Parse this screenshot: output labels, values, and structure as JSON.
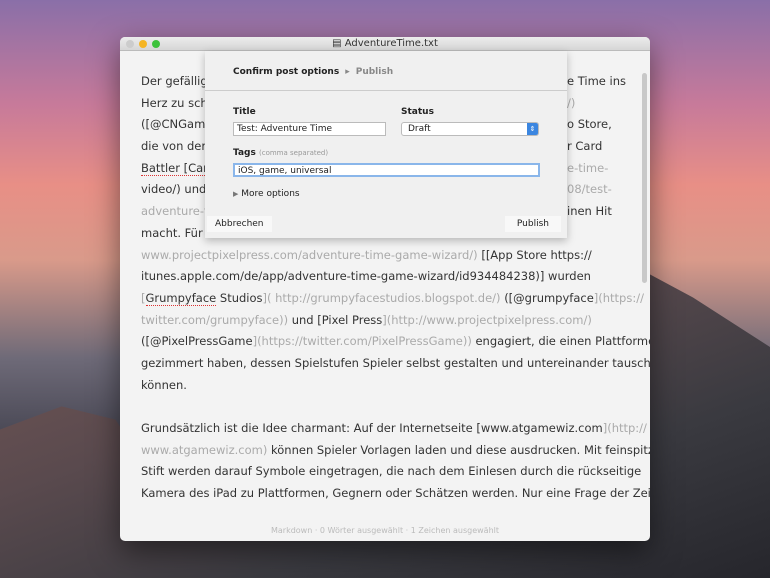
{
  "window": {
    "title": "AdventureTime.txt"
  },
  "sheet": {
    "breadcrumb": [
      "Confirm post options",
      "Publish"
    ],
    "title_label": "Title",
    "title_value": "Test: Adventure Time",
    "status_label": "Status",
    "status_value": "Draft",
    "tags_label": "Tags",
    "tags_hint": "(comma separated)",
    "tags_value": "iOS, game, universal",
    "more_options": "More options",
    "cancel": "Abbrechen",
    "publish": "Publish"
  },
  "lines": [
    [
      "Der gefällige",
      "e Time ins"
    ],
    [
      "Herz zu schli",
      "/)"
    ],
    [
      "([@CNGame",
      "o Store,"
    ],
    [
      "die von der I",
      "r Card"
    ],
    [
      "Battler [Card",
      "e-time-"
    ],
    [
      "video/) und d",
      "08/test-"
    ],
    [
      "adventure-ti",
      "inen Hit"
    ],
    [
      "macht. Für d",
      ""
    ]
  ],
  "para1": [
    "www.projectpixelpress.com/adventure-time-game-wizard/)",
    "[[App Store https://",
    "itunes.apple.com/de/app/adventure-time-game-wizard/id934484238)] wurden",
    "[",
    "Grumpyface",
    "Studios",
    "]( http://grumpyfacestudios.blogspot.de/)",
    "([@grumpyface",
    "](https://",
    "twitter.com/grumpyface))",
    "und [Pixel Press",
    "](http://www.projectpixelpress.com/)",
    "([@PixelPressGame",
    "](https://twitter.com/PixelPressGame))",
    "engagiert, die einen Plattformer",
    "gezimmert haben, dessen Spielstufen Spieler selbst gestalten und untereinander tauschen",
    "können."
  ],
  "para2": [
    "Grundsätzlich ist die Idee charmant: Auf der Internetseite [www.atgamewiz.com",
    "](http://",
    "www.atgamewiz.com)",
    "können Spieler Vorlagen laden und diese ausdrucken. Mit feinspitzem",
    "Stift werden darauf Symbole eingetragen, die nach dem Einlesen durch die rückseitige",
    "Kamera des iPad zu Plattformen, Gegnern oder Schätzen werden. Nur eine Frage der Zeit bis"
  ],
  "statusbar": "Markdown · 0 Wörter ausgewählt · 1 Zeichen ausgewählt"
}
